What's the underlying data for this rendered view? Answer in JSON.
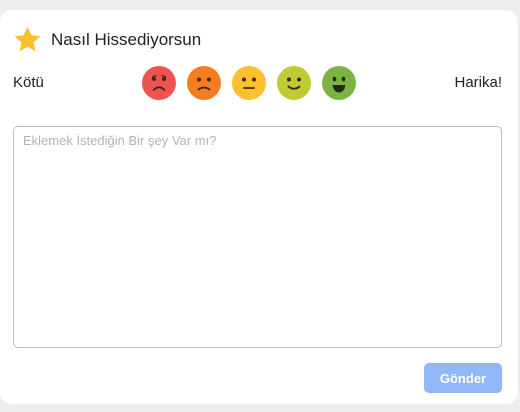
{
  "header": {
    "icon": "star-icon",
    "title": "Nasıl Hissediyorsun"
  },
  "rating": {
    "low_label": "Kötü",
    "high_label": "Harika!",
    "faces": [
      {
        "name": "very-sad-face-icon",
        "color": "#ef5350",
        "mood": "very-bad"
      },
      {
        "name": "sad-face-icon",
        "color": "#f57c1f",
        "mood": "bad"
      },
      {
        "name": "neutral-face-icon",
        "color": "#fbc02d",
        "mood": "neutral"
      },
      {
        "name": "smile-face-icon",
        "color": "#c0ca33",
        "mood": "good"
      },
      {
        "name": "happy-face-icon",
        "color": "#7cb342",
        "mood": "great"
      }
    ]
  },
  "comment": {
    "placeholder": "Eklemek İstediğin Bir şey Var mı?",
    "value": ""
  },
  "submit": {
    "label": "Gönder",
    "color": "#90b8f8"
  },
  "colors": {
    "star": "#fbc02d",
    "background": "#eeeeee",
    "card": "#ffffff"
  }
}
